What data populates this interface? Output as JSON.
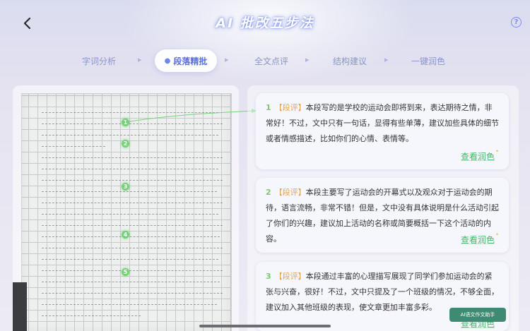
{
  "header": {
    "title": "AI 批改五步法",
    "back_icon": "chevron-left-icon",
    "help_label": "?"
  },
  "tabs": [
    {
      "label": "字词分析",
      "active": false
    },
    {
      "label": "段落精批",
      "active": true,
      "icon": "bulb-icon"
    },
    {
      "label": "全文点评",
      "active": false
    },
    {
      "label": "结构建议",
      "active": false
    },
    {
      "label": "一键润色",
      "active": false
    }
  ],
  "essay": {
    "markers": [
      "1",
      "2",
      "3",
      "4",
      "5"
    ]
  },
  "comments": [
    {
      "number": "1",
      "tag": "【段评】",
      "text": "本段写的是学校的运动会即将到来，表达期待之情，非常好！不过，文中只有一句话，显得有些单薄，建议加些具体的细节或者情感描述，比如你们的心情、表情等。",
      "link": "查看润色"
    },
    {
      "number": "2",
      "tag": "【段评】",
      "text": "本段主要写了运动会的开幕式以及观众对于运动会的期待，语言流畅，非常不错！但是，文中没有具体说明是什么活动引起了你们的兴趣，建议加上活动的名称或简要概括一下这个活动的内容。",
      "link": "查看润色"
    },
    {
      "number": "3",
      "tag": "【段评】",
      "text": "本段通过丰富的心理描写展现了同学们参加运动会的紧张与兴奋，很好！不过，文中只提及了一个班级的情况，不够全面，建议加入其他班级的表现，使文章更加丰富多彩。",
      "link": "查看润色"
    }
  ],
  "assistant_button": "AI语文作文助手",
  "colors": {
    "accent": "#5a6fd8",
    "marker": "#7ad07a",
    "tag": "#e3a24f",
    "link": "#43b66a",
    "assistant": "#3f8a72"
  }
}
